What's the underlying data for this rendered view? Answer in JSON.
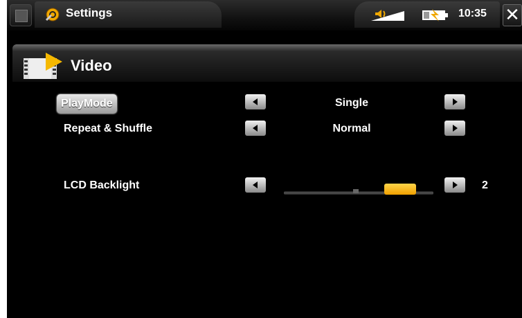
{
  "header": {
    "app_title": "Settings",
    "clock": "10:35",
    "icons": [
      "home-icon",
      "gear-icon",
      "speaker-icon",
      "battery-icon",
      "close-icon"
    ]
  },
  "section": {
    "title": "Video",
    "icon": "film-icon"
  },
  "settings": [
    {
      "label": "PlayMode",
      "value": "Single",
      "selected": true
    },
    {
      "label": "Repeat & Shuffle",
      "value": "Normal",
      "selected": false
    },
    {
      "label": "LCD Backlight",
      "value": "2",
      "selected": false,
      "slider_level": 0.85
    }
  ],
  "colors": {
    "accent": "#f5b800",
    "background": "#000000"
  }
}
